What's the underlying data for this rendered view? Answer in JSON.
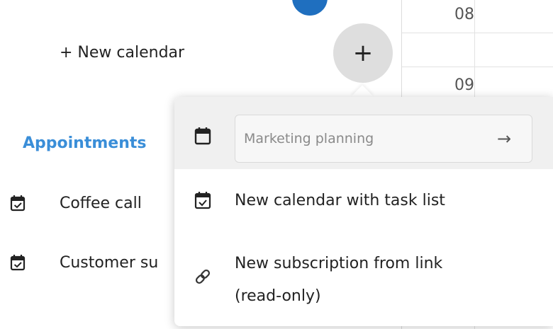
{
  "sidebar": {
    "new_calendar_label": "+ New calendar",
    "section_title": "Appointments",
    "items": [
      {
        "label": "Coffee call",
        "icon": "calendar-check-icon"
      },
      {
        "label": "Customer su",
        "icon": "calendar-check-icon"
      }
    ],
    "add_button_glyph": "+"
  },
  "calendar_grid": {
    "hours": [
      "08",
      "09"
    ]
  },
  "popover": {
    "input": {
      "value": "",
      "placeholder": "Marketing planning"
    },
    "submit_glyph": "→",
    "items": [
      {
        "label": "New calendar with task list",
        "icon": "calendar-check-icon"
      },
      {
        "label_line1": "New subscription from link",
        "label_line2": "(read-only)",
        "icon": "link-icon"
      }
    ]
  },
  "colors": {
    "accent": "#3a8ed8",
    "primary_blue": "#1f6fbf",
    "button_bg": "#dedede",
    "input_row_bg": "#f0f0f0"
  }
}
